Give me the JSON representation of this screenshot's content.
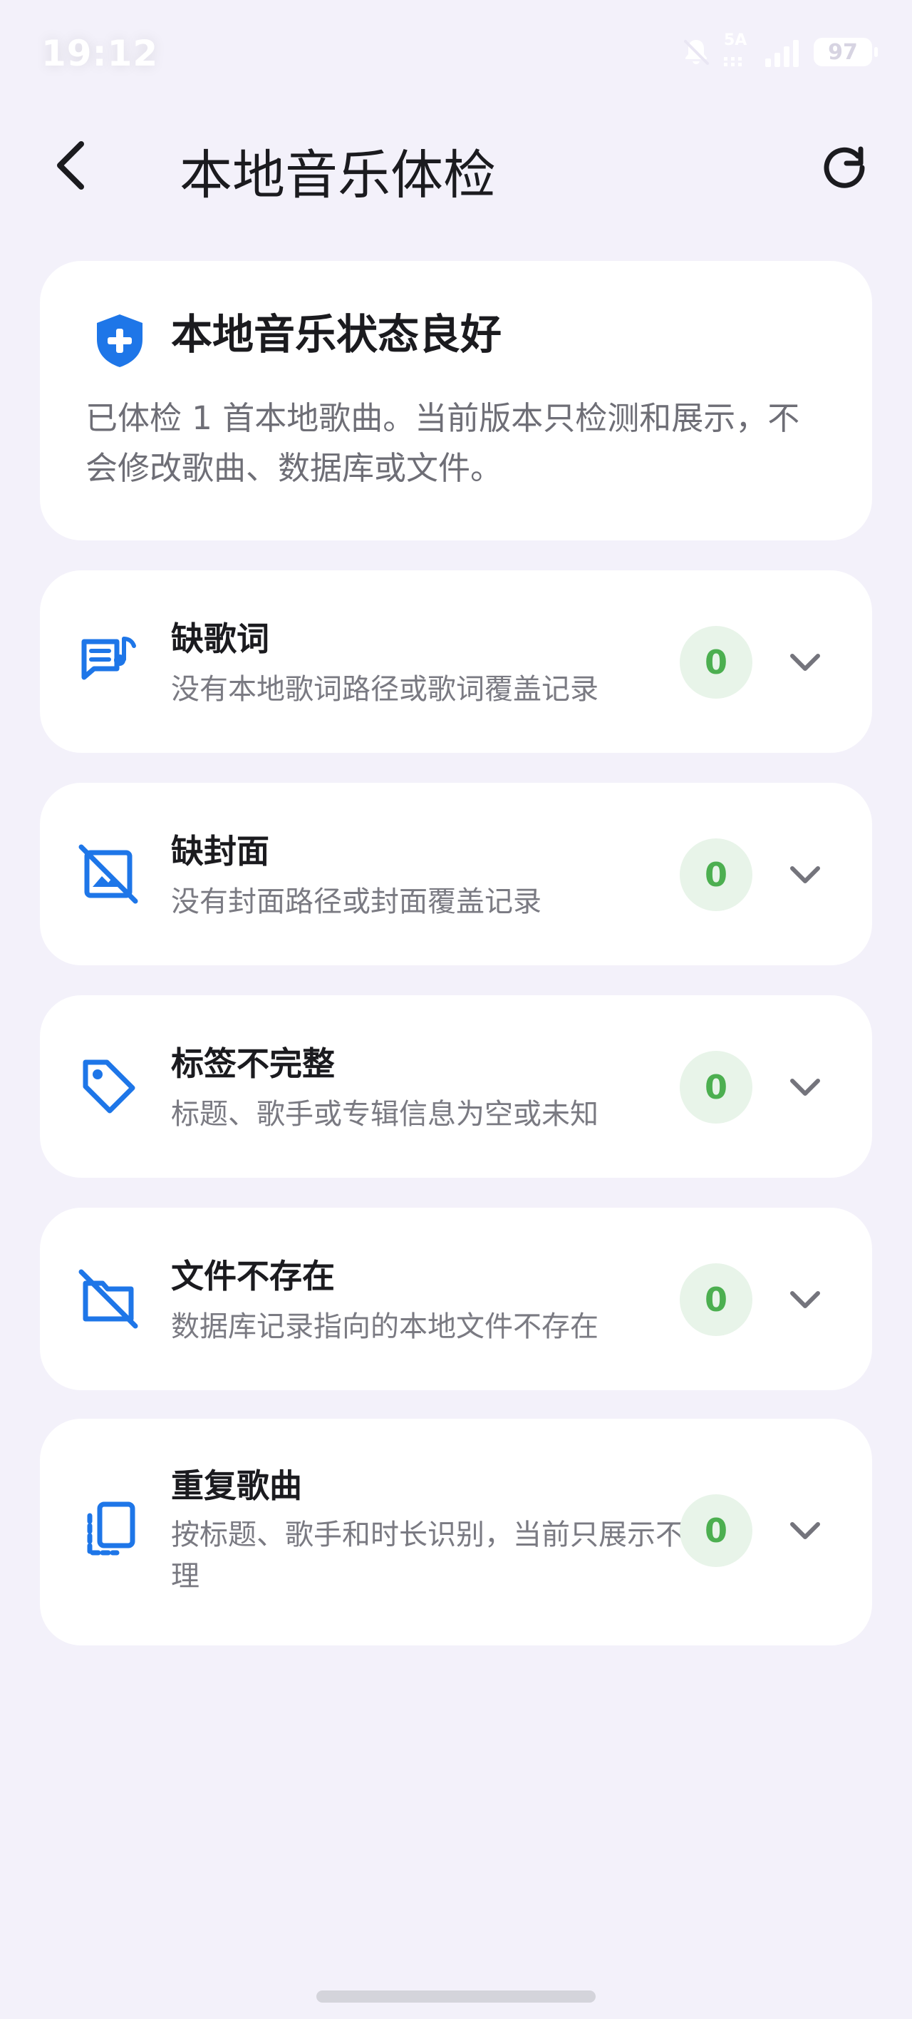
{
  "status_bar": {
    "time": "19:12",
    "network_type": "5A",
    "battery_level": "97"
  },
  "header": {
    "title": "本地音乐体检",
    "back_icon": "chevron-left-icon",
    "refresh_icon": "refresh-icon"
  },
  "summary": {
    "icon": "shield-plus-icon",
    "title": "本地音乐状态良好",
    "description": "已体检 1 首本地歌曲。当前版本只检测和展示，不会修改歌曲、数据库或文件。"
  },
  "checks": [
    {
      "icon": "lyrics-icon",
      "title": "缺歌词",
      "description": "没有本地歌词路径或歌词覆盖记录",
      "count": "0"
    },
    {
      "icon": "missing-cover-icon",
      "title": "缺封面",
      "description": "没有封面路径或封面覆盖记录",
      "count": "0"
    },
    {
      "icon": "tag-icon",
      "title": "标签不完整",
      "description": "标题、歌手或专辑信息为空或未知",
      "count": "0"
    },
    {
      "icon": "missing-file-icon",
      "title": "文件不存在",
      "description": "数据库记录指向的本地文件不存在",
      "count": "0"
    },
    {
      "icon": "duplicate-icon",
      "title": "重复歌曲",
      "description": "按标题、歌手和时长识别，当前只展示不处理",
      "count": "0"
    }
  ],
  "colors": {
    "background": "#F3F1FA",
    "card": "#FFFFFF",
    "accent_blue": "#1E76E8",
    "success_green": "#4CAF50",
    "success_bg": "#E8F4E9",
    "secondary_text": "#7A7A82"
  }
}
